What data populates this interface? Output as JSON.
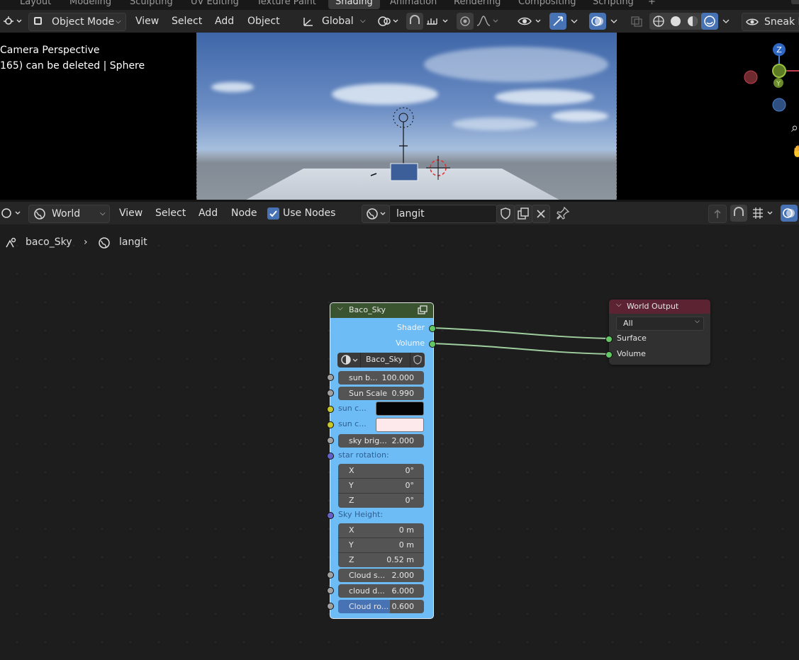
{
  "workspace_tabs": [
    "Layout",
    "Modeling",
    "Sculpting",
    "UV Editing",
    "Texture Paint",
    "Shading",
    "Animation",
    "Rendering",
    "Compositing",
    "Scripting",
    "+"
  ],
  "viewport_header": {
    "mode": "Object Mode",
    "menus": [
      "View",
      "Select",
      "Add",
      "Object"
    ],
    "orientation": "Global",
    "sneak_label": "Sneak P"
  },
  "viewport": {
    "info_line1": "Camera Perspective",
    "info_line2": "165) can be deleted | Sphere",
    "gizmo": {
      "z": "Z",
      "y": "Y"
    }
  },
  "node_header": {
    "editor_type": "World",
    "menus": [
      "View",
      "Select",
      "Add",
      "Node"
    ],
    "use_nodes_label": "Use Nodes",
    "use_nodes_checked": true,
    "world_name": "langit"
  },
  "breadcrumb": {
    "scene": "baco_Sky",
    "world": "langit"
  },
  "baco_node": {
    "title": "Baco_Sky",
    "outputs": [
      "Shader",
      "Volume"
    ],
    "group_name": "Baco_Sky",
    "fields": [
      {
        "label": "sun b...",
        "value": "100.000"
      },
      {
        "label": "Sun Scale",
        "value": "0.990"
      }
    ],
    "color_labels": [
      "sun c...",
      "sun c..."
    ],
    "colors": [
      "#050505",
      "#fde8ec"
    ],
    "sky_brightness": {
      "label": "sky brig...",
      "value": "2.000"
    },
    "star_rotation_label": "star rotation:",
    "star_rotation": [
      {
        "axis": "X",
        "value": "0°"
      },
      {
        "axis": "Y",
        "value": "0°"
      },
      {
        "axis": "Z",
        "value": "0°"
      }
    ],
    "sky_height_label": "Sky Height:",
    "sky_height": [
      {
        "axis": "X",
        "value": "0 m"
      },
      {
        "axis": "Y",
        "value": "0 m"
      },
      {
        "axis": "Z",
        "value": "0.52 m"
      }
    ],
    "bottom_fields": [
      {
        "label": "Cloud s...",
        "value": "2.000"
      },
      {
        "label": "cloud d...",
        "value": "6.000"
      },
      {
        "label": "Cloud ro...",
        "value": "0.600",
        "fraction": 0.6
      }
    ]
  },
  "world_output_node": {
    "title": "World Output",
    "target": "All",
    "inputs": [
      "Surface",
      "Volume"
    ]
  },
  "colors": {
    "accent": "#4772b3",
    "node_body": "#6ebcf5",
    "socket_green": "#63c763",
    "socket_yellow": "#c7c729",
    "socket_purple": "#6363c7",
    "socket_gray": "#a1a1a1"
  }
}
